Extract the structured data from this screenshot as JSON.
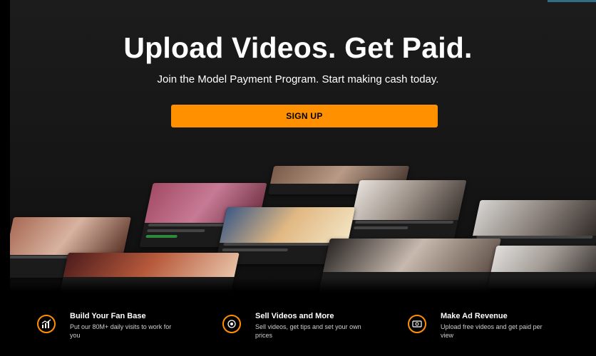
{
  "hero": {
    "title": "Upload Videos. Get Paid.",
    "subtitle": "Join the Model Payment Program. Start making cash today.",
    "signup_label": "SIGN UP"
  },
  "features": [
    {
      "icon": "growth-chart-icon",
      "title": "Build Your Fan Base",
      "description": "Put our 80M+ daily visits to work for you"
    },
    {
      "icon": "camera-icon",
      "title": "Sell Videos and More",
      "description": "Sell videos, get tips and set your own prices"
    },
    {
      "icon": "cash-icon",
      "title": "Make Ad Revenue",
      "description": "Upload free videos and get paid per view"
    }
  ],
  "colors": {
    "accent": "#ff9000",
    "background": "#000000",
    "corner": "#2f6e86"
  }
}
